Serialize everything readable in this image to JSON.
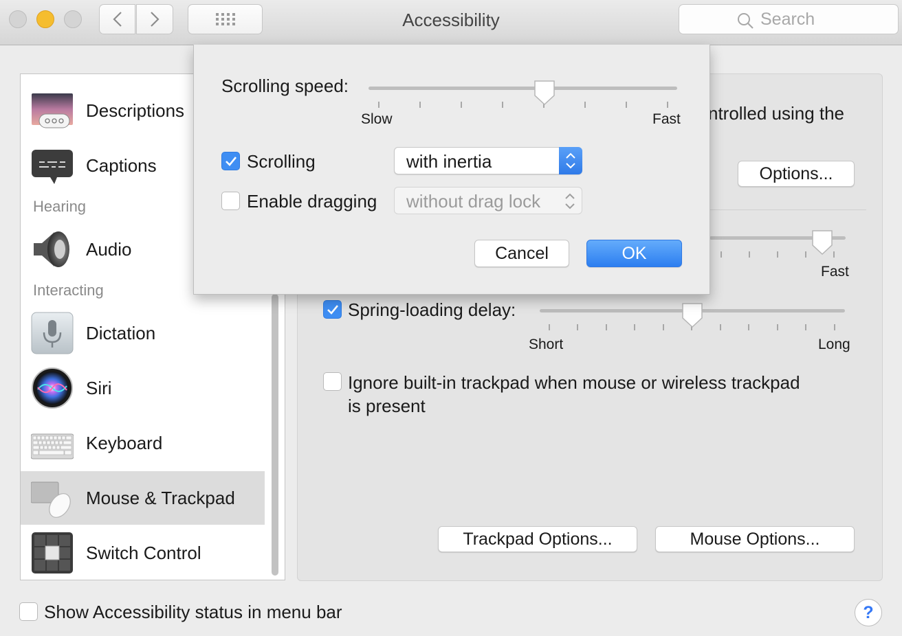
{
  "window": {
    "title": "Accessibility"
  },
  "search": {
    "placeholder": "Search"
  },
  "sidebar": {
    "items": [
      {
        "label": "Descriptions",
        "icon": "speech-bubble-dots-icon"
      },
      {
        "label": "Captions",
        "icon": "captions-icon"
      },
      {
        "label": "Audio",
        "icon": "speaker-icon"
      },
      {
        "label": "Dictation",
        "icon": "microphone-icon"
      },
      {
        "label": "Siri",
        "icon": "siri-icon"
      },
      {
        "label": "Keyboard",
        "icon": "keyboard-icon"
      },
      {
        "label": "Mouse & Trackpad",
        "icon": "mouse-trackpad-icon",
        "selected": true
      },
      {
        "label": "Switch Control",
        "icon": "switch-control-icon"
      }
    ],
    "headers": {
      "hearing": "Hearing",
      "interacting": "Interacting"
    }
  },
  "panel": {
    "partial_text": "ntrolled using the",
    "options_button": "Options...",
    "double_click_fast_label": "Fast",
    "double_click_speed_value": 0.83,
    "spring_loading": {
      "label": "Spring-loading delay:",
      "checked": true,
      "min_label": "Short",
      "max_label": "Long",
      "value": 0.5
    },
    "ignore_trackpad": {
      "label_line1": "Ignore built-in trackpad when mouse or wireless trackpad",
      "label_line2": "is present",
      "checked": false
    },
    "trackpad_options_button": "Trackpad Options...",
    "mouse_options_button": "Mouse Options..."
  },
  "sheet": {
    "scrolling_speed": {
      "label": "Scrolling speed:",
      "min_label": "Slow",
      "max_label": "Fast",
      "value": 0.57
    },
    "scrolling": {
      "label": "Scrolling",
      "checked": true,
      "value": "with inertia"
    },
    "dragging": {
      "label": "Enable dragging",
      "checked": false,
      "value": "without drag lock"
    },
    "cancel_button": "Cancel",
    "ok_button": "OK"
  },
  "footer": {
    "show_status": {
      "label": "Show Accessibility status in menu bar",
      "checked": false
    },
    "help_button": "?"
  },
  "colors": {
    "accent": "#3f8ef3",
    "ok_button": "#2c7ef0",
    "traffic_minimize": "#f5bd2f"
  }
}
